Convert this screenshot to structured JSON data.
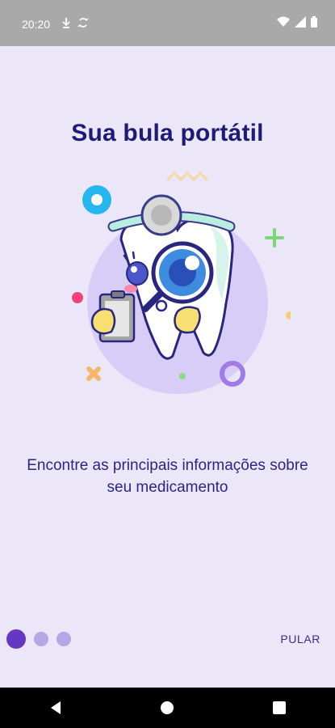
{
  "status_bar": {
    "time": "20:20",
    "left_icons": [
      "download-icon",
      "sync-icon"
    ],
    "right_icons": [
      "wifi-icon",
      "signal-icon",
      "battery-icon"
    ]
  },
  "onboarding": {
    "title": "Sua bula portátil",
    "subtitle": "Encontre as principais informações sobre seu medicamento",
    "illustration": "tooth-doctor-magnifier-illustration",
    "page_index": 1,
    "page_count": 3,
    "skip_label": "PULAR"
  },
  "colors": {
    "background": "#ECE7F8",
    "title": "#1E1A78",
    "accent": "#6438C0",
    "dot_inactive": "#B6A6E4"
  },
  "nav_bar": {
    "buttons": [
      "back-icon",
      "home-icon",
      "recents-icon"
    ]
  }
}
